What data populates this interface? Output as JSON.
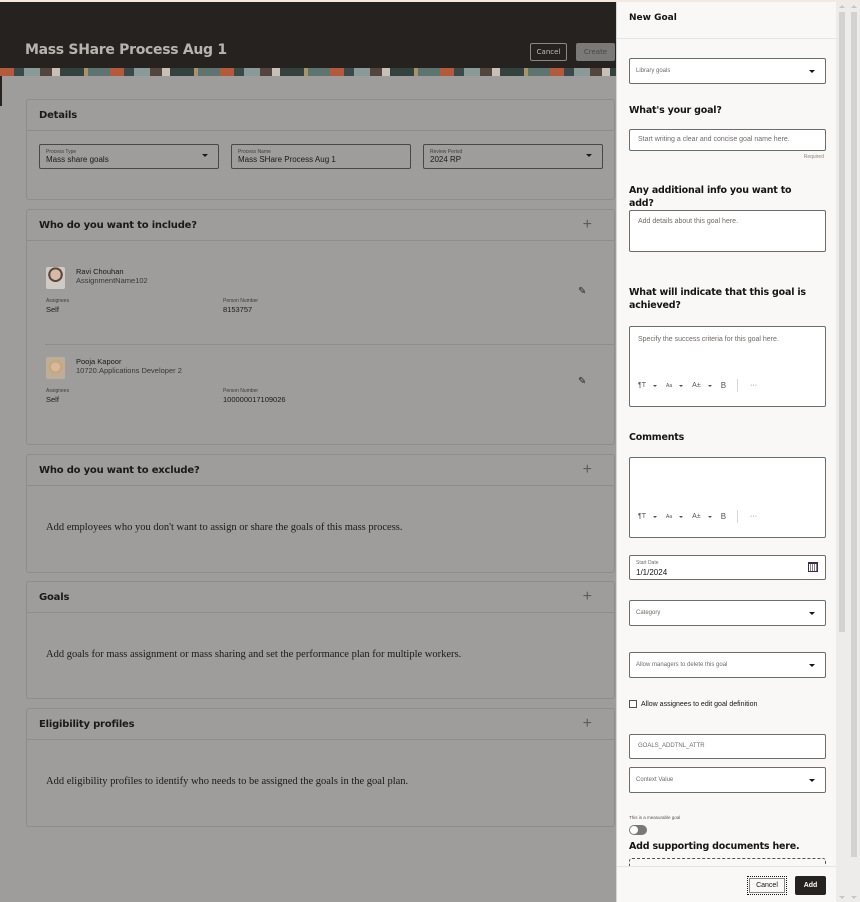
{
  "page": {
    "title": "Mass SHare Process Aug 1",
    "cancel_label": "Cancel",
    "create_label": "Create"
  },
  "details": {
    "title": "Details",
    "fields": [
      {
        "label": "Process Type",
        "value": "Mass share goals",
        "type": "select"
      },
      {
        "label": "Process Name",
        "value": "Mass SHare Process Aug 1",
        "type": "text"
      },
      {
        "label": "Review Period",
        "value": "2024 RP",
        "type": "select"
      }
    ]
  },
  "include": {
    "title": "Who do you want to include?",
    "people": [
      {
        "name": "Ravi Chouhan",
        "assignment": "AssignmentName102",
        "assignees_label": "Assignees",
        "assignees": "Self",
        "person_number_label": "Person Number",
        "person_number": "8153757"
      },
      {
        "name": "Pooja Kapoor",
        "assignment": "10720.Applications Developer 2",
        "assignees_label": "Assignees",
        "assignees": "Self",
        "person_number_label": "Person Number",
        "person_number": "100000017109026"
      }
    ]
  },
  "exclude": {
    "title": "Who do you want to exclude?",
    "message": "Add employees who you don't want to assign or share the goals of this mass process."
  },
  "goals": {
    "title": "Goals",
    "message": "Add goals for mass assignment or mass sharing and set the performance plan for multiple workers."
  },
  "eligibility": {
    "title": "Eligibility profiles",
    "message": "Add eligibility profiles to identify who needs to be assigned the goals in the goal plan."
  },
  "drawer": {
    "title": "New Goal",
    "library_placeholder": "Library goals",
    "goal_heading": "What's your goal?",
    "goal_placeholder": "Start writing a clear and concise goal name here.",
    "required_label": "Required",
    "info_heading": "Any additional info you want to add?",
    "info_placeholder": "Add details about this goal here.",
    "success_heading": "What will indicate that this goal is achieved?",
    "success_placeholder": "Specify the success criteria for this goal here.",
    "comments_heading": "Comments",
    "toolbar": {
      "format": "¶T",
      "font": "Aa",
      "size": "A±",
      "bold": "B",
      "more": "···"
    },
    "start_date_label": "Start Date",
    "start_date_value": "1/1/2024",
    "category_placeholder": "Category",
    "managers_delete_placeholder": "Allow managers to delete this goal",
    "allow_edit_label": "Allow assignees to edit goal definition",
    "allow_edit_checked": false,
    "addl_attr_value": "GOALS_ADDTNL_ATTR",
    "context_placeholder": "Context Value",
    "measurable_label": "This is a measurable goal",
    "measurable_on": false,
    "docs_heading": "Add supporting documents here.",
    "cancel_label": "Cancel",
    "add_label": "Add"
  }
}
